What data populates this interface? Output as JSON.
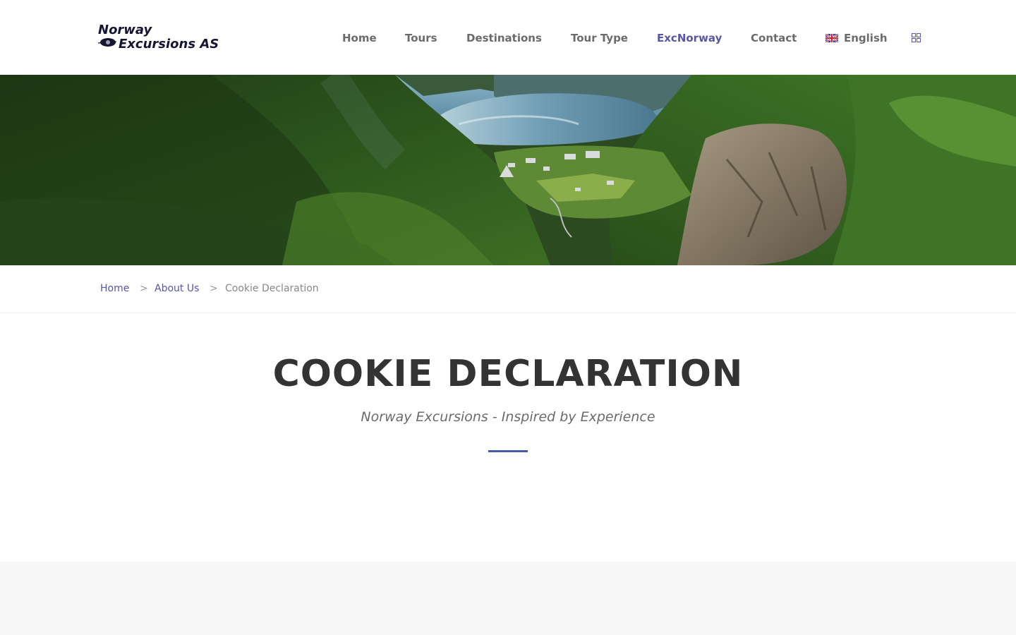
{
  "brand": {
    "logo_line1": "Norway",
    "logo_line2": "Excursions AS"
  },
  "nav": {
    "items": [
      {
        "label": "Home"
      },
      {
        "label": "Tours"
      },
      {
        "label": "Destinations"
      },
      {
        "label": "Tour Type"
      },
      {
        "label": "ExcNorway",
        "active": true
      },
      {
        "label": "Contact"
      }
    ],
    "language": {
      "label": "English",
      "flag": "uk-flag-icon"
    },
    "menu_icon": "grid-icon"
  },
  "breadcrumb": {
    "items": [
      "Home",
      "About Us",
      "Cookie Declaration"
    ],
    "separator": ">"
  },
  "page": {
    "title": "COOKIE DECLARATION",
    "subtitle": "Norway Excursions - Inspired by Experience"
  },
  "colors": {
    "accent": "#5856a6",
    "divider": "#4b5aa8",
    "nav_text": "#6b6b6b",
    "title": "#333333",
    "footer_band": "#f7f7f7"
  }
}
